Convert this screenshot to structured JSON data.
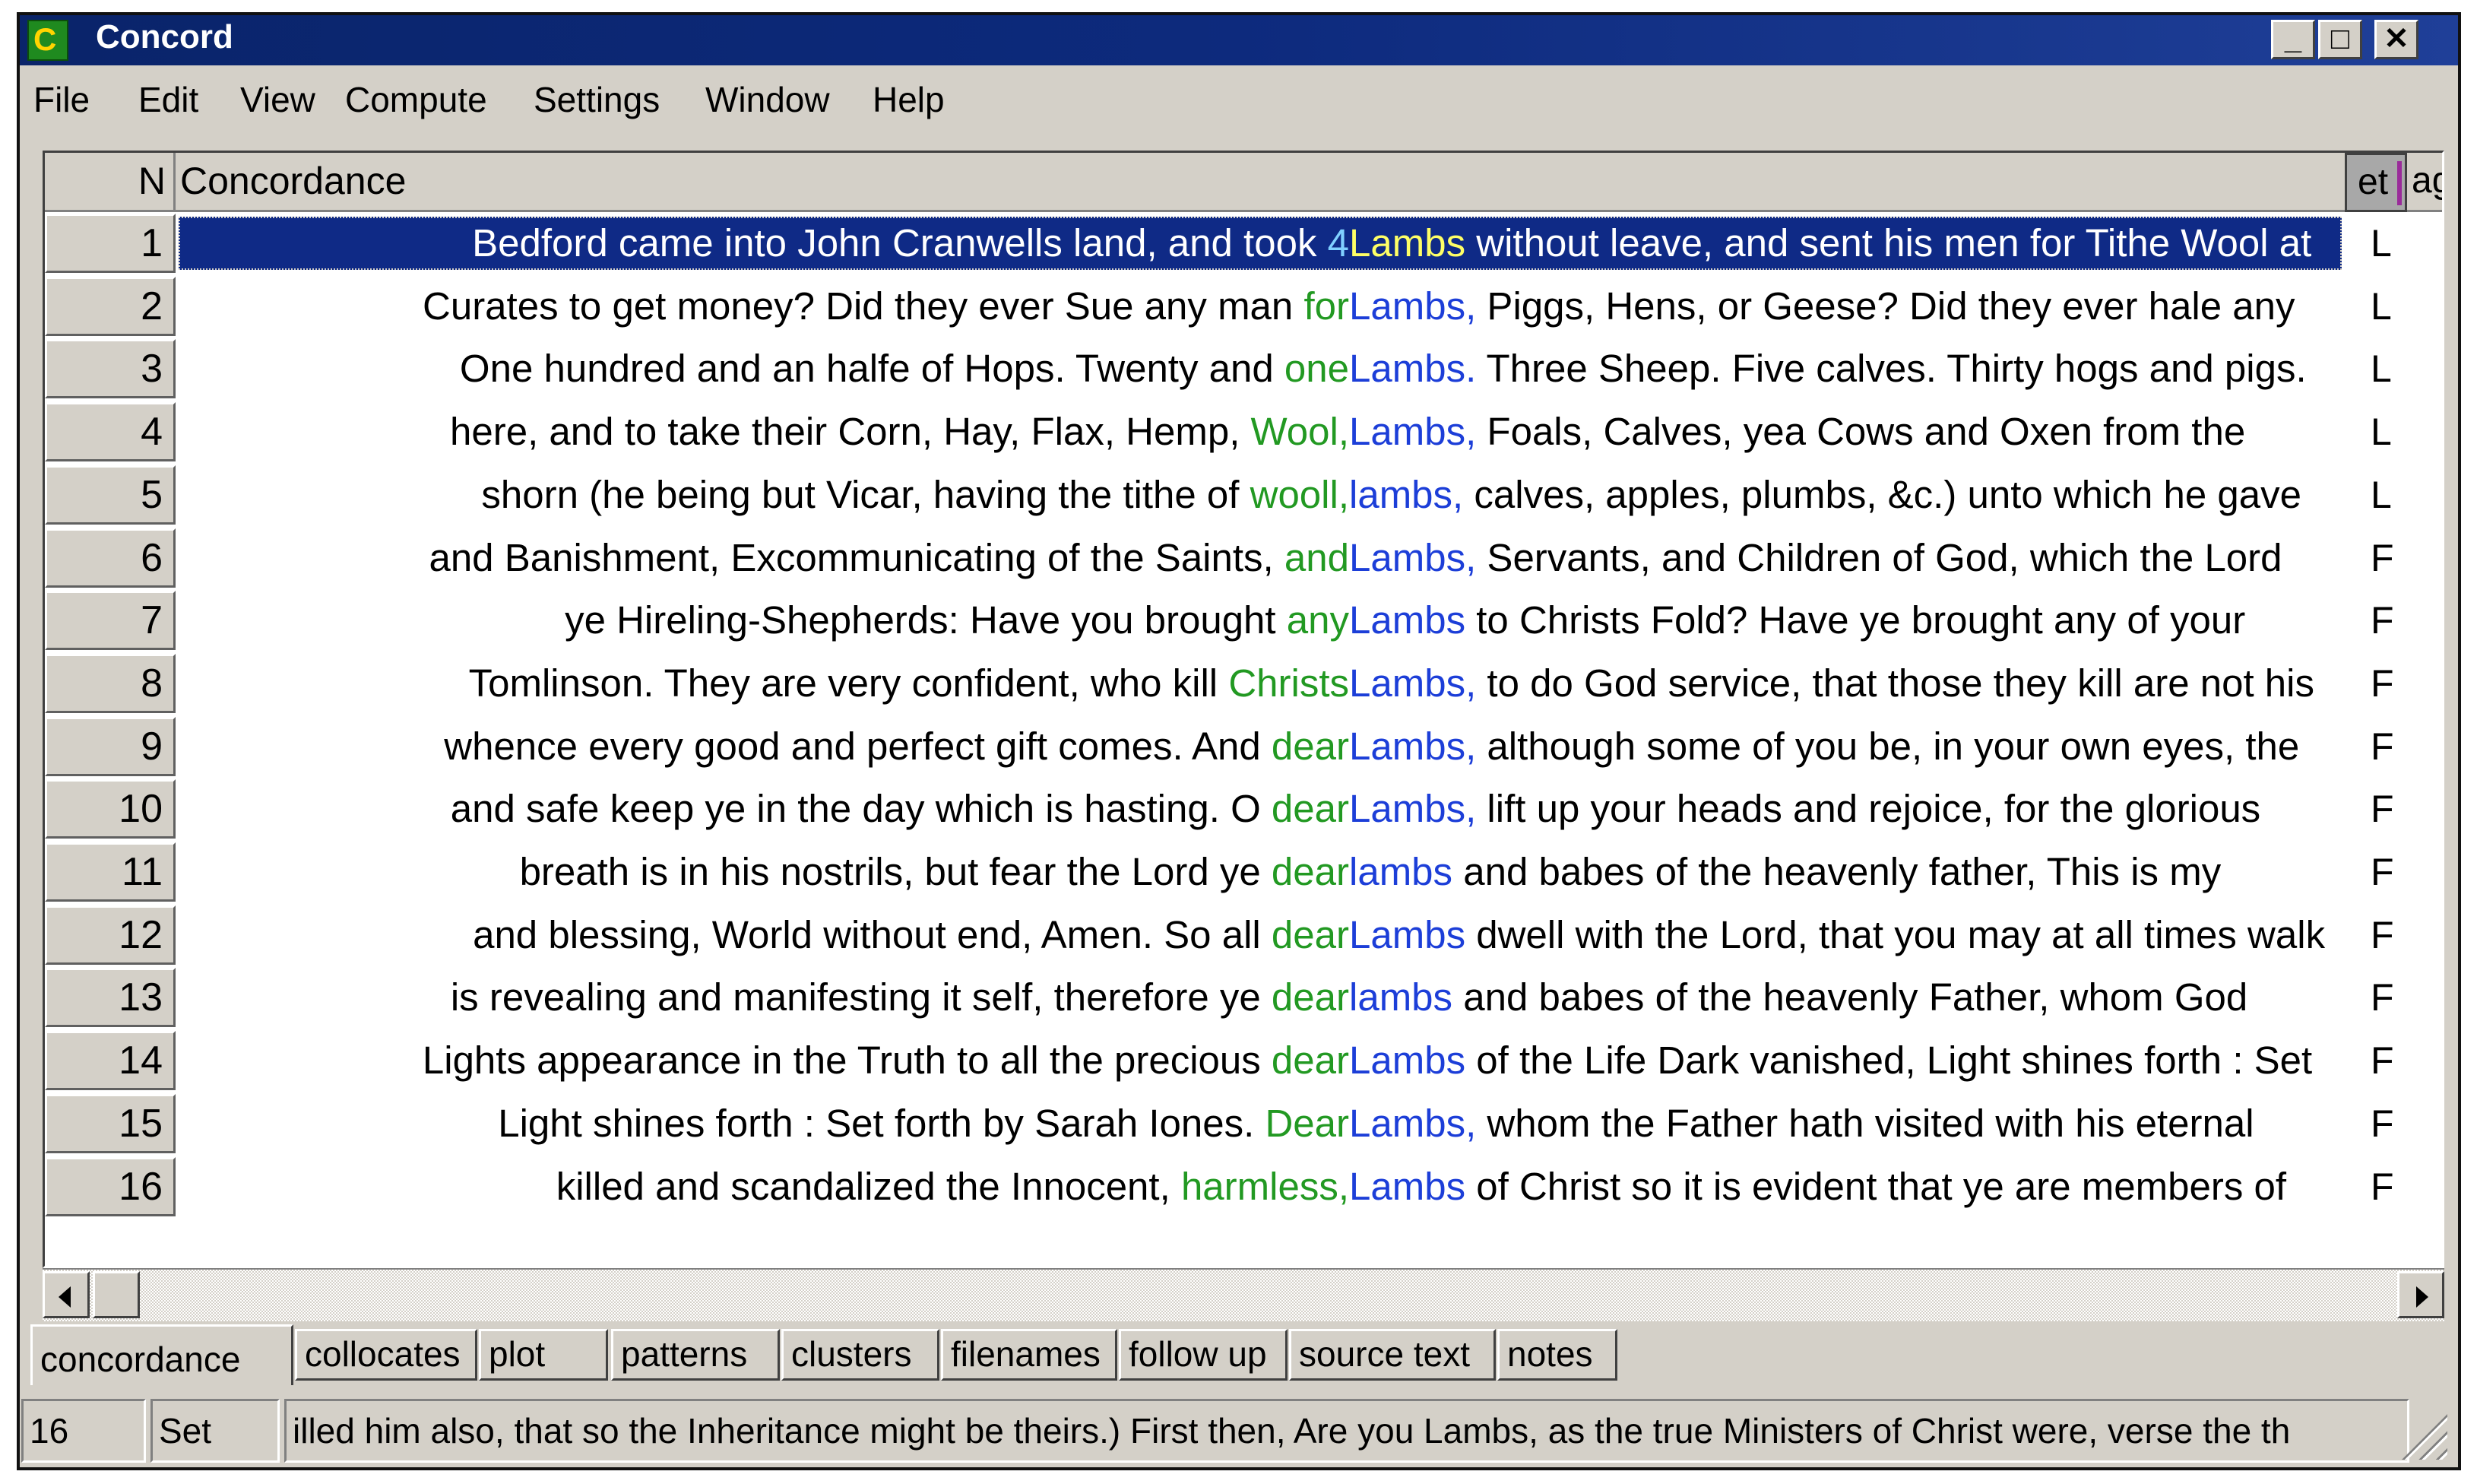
{
  "window": {
    "title": "Concord"
  },
  "menu": [
    "File",
    "Edit",
    "View",
    "Compute",
    "Settings",
    "Window",
    "Help"
  ],
  "grid": {
    "headers": {
      "n": "N",
      "concordance": "Concordance",
      "col3": "et",
      "col4": "ag"
    },
    "rows": [
      {
        "n": "1",
        "left": "Bedford came into John Cranwells land, and took",
        "col": "4",
        "kw": "Lambs",
        "right": "without leave, and sent his men for Tithe Wool at",
        "tag": "L"
      },
      {
        "n": "2",
        "left": "Curates to get money? Did they ever Sue any man",
        "col": "for",
        "kw": "Lambs,",
        "right": "Piggs, Hens, or Geese? Did they ever hale any",
        "tag": "L"
      },
      {
        "n": "3",
        "left": "One hundred and an halfe of Hops. Twenty and",
        "col": "one",
        "kw": "Lambs.",
        "right": "Three Sheep. Five calves. Thirty hogs and pigs.",
        "tag": "L"
      },
      {
        "n": "4",
        "left": "here, and to take their Corn, Hay, Flax, Hemp,",
        "col": "Wool,",
        "kw": "Lambs,",
        "right": "Foals, Calves, yea Cows and Oxen from the",
        "tag": "L"
      },
      {
        "n": "5",
        "left": "shorn (he being but Vicar, having the tithe of",
        "col": "wooll,",
        "kw": "lambs,",
        "right": "calves, apples, plumbs, &c.) unto which he gave",
        "tag": "L"
      },
      {
        "n": "6",
        "left": "and Banishment, Excommunicating of the Saints,",
        "col": "and",
        "kw": "Lambs,",
        "right": "Servants, and Children of God, which the Lord",
        "tag": "F"
      },
      {
        "n": "7",
        "left": "ye Hireling-Shepherds: Have you brought",
        "col": "any",
        "kw": "Lambs",
        "right": "to Christs Fold? Have ye brought any of your",
        "tag": "F"
      },
      {
        "n": "8",
        "left": "Tomlinson. They are very confident, who kill",
        "col": "Christs",
        "kw": "Lambs,",
        "right": "to do God service, that those they kill are not his",
        "tag": "F"
      },
      {
        "n": "9",
        "left": "whence every good and perfect gift comes. And",
        "col": "dear",
        "kw": "Lambs,",
        "right": "although some of you be, in your own eyes, the",
        "tag": "F"
      },
      {
        "n": "10",
        "left": "and safe keep ye in the day which is hasting. O",
        "col": "dear",
        "kw": "Lambs,",
        "right": "lift up your heads and rejoice, for the glorious",
        "tag": "F"
      },
      {
        "n": "11",
        "left": "breath is in his nostrils, but fear the Lord ye",
        "col": "dear",
        "kw": "lambs",
        "right": "and babes of the heavenly father, This is my",
        "tag": "F"
      },
      {
        "n": "12",
        "left": "and blessing, World without end, Amen. So all",
        "col": "dear",
        "kw": "Lambs",
        "right": "dwell with the Lord, that you may at all times walk",
        "tag": "F"
      },
      {
        "n": "13",
        "left": "is revealing and manifesting it self, therefore ye",
        "col": "dear",
        "kw": "lambs",
        "right": "and babes of the heavenly Father, whom God",
        "tag": "F"
      },
      {
        "n": "14",
        "left": "Lights appearance in the Truth to all the precious",
        "col": "dear",
        "kw": "Lambs",
        "right": "of the Life Dark vanished, Light shines forth : Set",
        "tag": "F"
      },
      {
        "n": "15",
        "left": "Light shines forth : Set forth by Sarah Iones.",
        "col": "Dear",
        "kw": "Lambs,",
        "right": "whom the Father hath visited with his eternal",
        "tag": "F"
      },
      {
        "n": "16",
        "left": "killed and scandalized the Innocent,",
        "col": "harmless,",
        "kw": "Lambs",
        "right": "of Christ so it is evident that ye are members of",
        "tag": "F"
      }
    ]
  },
  "tabs": [
    "concordance",
    "collocates",
    "plot",
    "patterns",
    "clusters",
    "filenames",
    "follow up",
    "source text",
    "notes"
  ],
  "status": {
    "count": "16",
    "set": "Set",
    "text": "illed him also, that so the Inheritance might be theirs.) First then, Are you Lambs, as the true Ministers of Christ were, verse the th"
  },
  "colors": {
    "keyword": "#1c3ed8",
    "collocate": "#229922",
    "selection": "#0f2a86",
    "titlebar": "#0a246a"
  }
}
